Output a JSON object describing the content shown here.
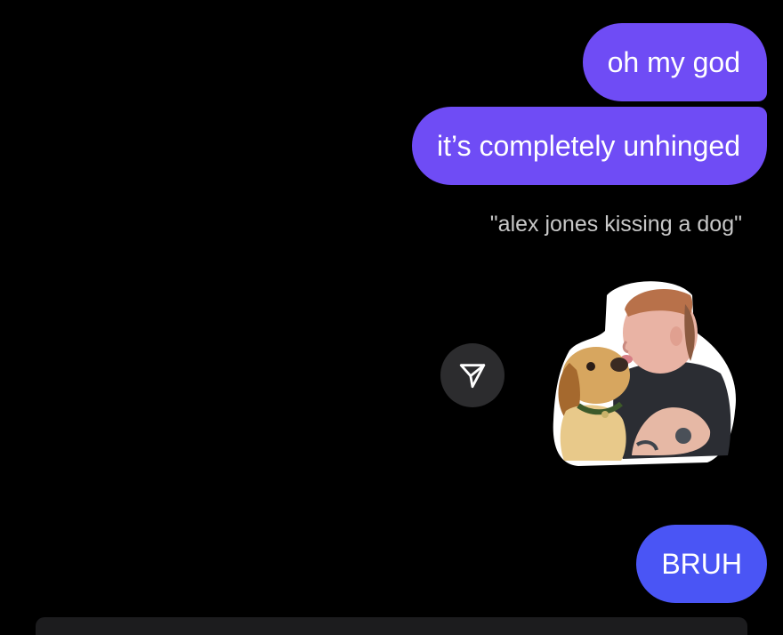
{
  "messages": [
    {
      "id": "m1",
      "text": "oh my god",
      "sender": "me"
    },
    {
      "id": "m2",
      "text": "it’s completely unhinged",
      "sender": "me"
    },
    {
      "id": "m3",
      "text": "BRUH",
      "sender": "me"
    }
  ],
  "sticker": {
    "caption": "\"alex jones kissing a dog\"",
    "icon": "send-paper-plane-icon"
  },
  "colors": {
    "background": "#000000",
    "bubble_purple": "#6f4cf5",
    "bubble_blue": "#4a55f5",
    "caption_text": "#c8c8c8",
    "share_button": "#2c2c2e"
  }
}
